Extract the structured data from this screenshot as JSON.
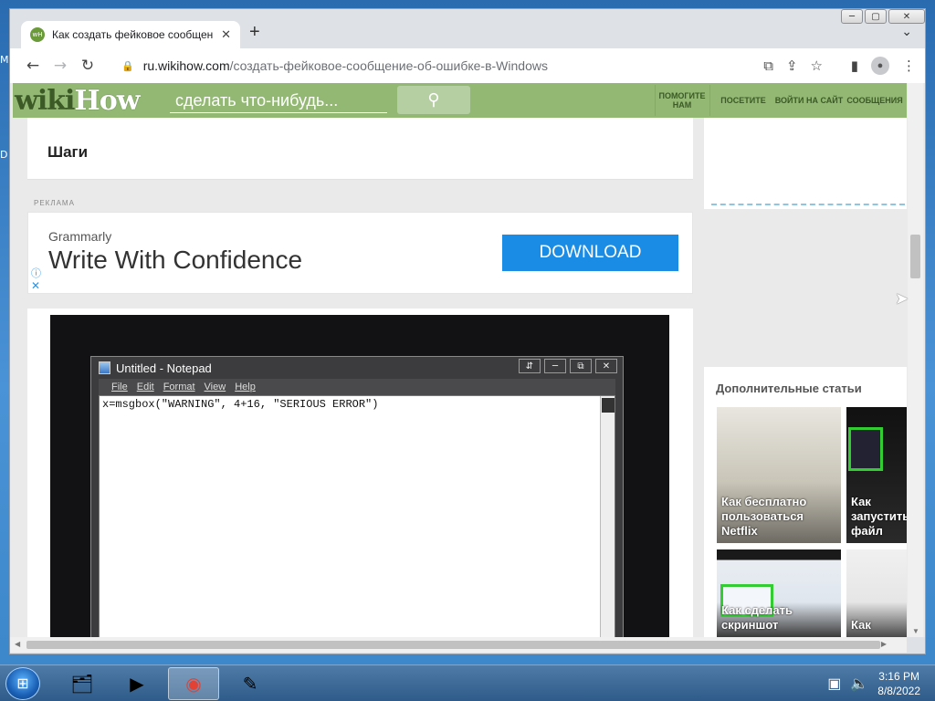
{
  "desktop": {
    "label_m": "M",
    "label_d": "D"
  },
  "window": {
    "min": "─",
    "max": "▢",
    "close": "✕"
  },
  "tab": {
    "title": "Как создать фейковое сообщен",
    "close": "✕",
    "new_tab": "+",
    "tab_search": "⌄"
  },
  "toolbar": {
    "back": "←",
    "forward": "→",
    "reload": "↻",
    "lock": "🔒",
    "url_host": "ru.wikihow.com",
    "url_path": "/создать-фейковое-сообщение-об-ошибке-в-Windows",
    "translate": "⧉",
    "share": "⇪",
    "bookmark": "☆",
    "sidepanel": "▮",
    "profile": "●",
    "menu": "⋮"
  },
  "wikihow": {
    "logo_wiki": "wiki",
    "logo_how": "How",
    "search_placeholder": "сделать что-нибудь...",
    "search_icon": "⚲",
    "nav": [
      "ПОМОГИТЕ НАМ",
      "ПОСЕТИТЕ",
      "ВОЙТИ НА САЙТ",
      "СООБЩЕНИЯ"
    ]
  },
  "article": {
    "steps_title": "Шаги"
  },
  "ad": {
    "label": "РЕКЛАМА",
    "brand": "Grammarly",
    "headline": "Write With Confidence",
    "button": "DOWNLOAD",
    "info": "ⓘ",
    "close": "✕"
  },
  "notepad": {
    "title": "Untitled - Notepad",
    "menu": [
      "File",
      "Edit",
      "Format",
      "View",
      "Help"
    ],
    "content": "x=msgbox(\"WARNING\", 4+16, \"SERIOUS ERROR\")",
    "btns": [
      "⇵",
      "─",
      "⧉",
      "✕"
    ]
  },
  "sidebar": {
    "heading": "Дополнительные статьи",
    "cards": [
      {
        "label": "Как бесплатно пользоваться Netflix"
      },
      {
        "label": "Как запустить файл"
      },
      {
        "label": "Как сделать скриншот"
      },
      {
        "label": "Как"
      }
    ]
  },
  "taskbar": {
    "start": "⊞",
    "apps": [
      "🗂",
      "▶",
      "◉",
      "✎"
    ],
    "network": "▣",
    "volume": "🔈",
    "time": "3:16 PM",
    "date": "8/8/2022"
  }
}
